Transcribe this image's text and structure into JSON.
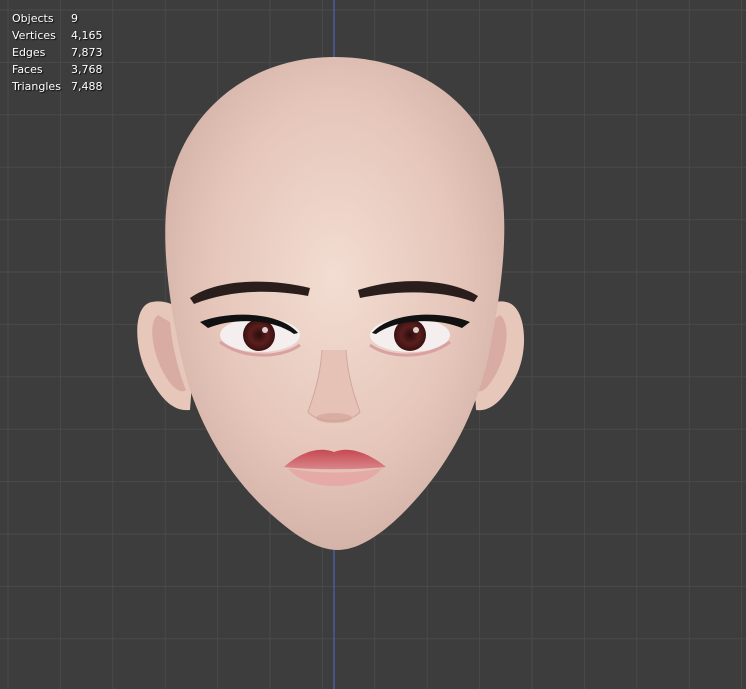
{
  "viewport": {
    "background_color": "#3d3d3d",
    "grid_line_color": "#4a4a4a",
    "axis_line_color": "#4a6ad0"
  },
  "overlay_stats": [
    {
      "label": "Objects",
      "value": "9"
    },
    {
      "label": "Vertices",
      "value": "4,165"
    },
    {
      "label": "Edges",
      "value": "7,873"
    },
    {
      "label": "Faces",
      "value": "3,768"
    },
    {
      "label": "Triangles",
      "value": "7,488"
    }
  ],
  "model": {
    "skin_color": "#e8c9bd",
    "lip_color": "#c9505a",
    "iris_color": "#5a1f1e"
  }
}
